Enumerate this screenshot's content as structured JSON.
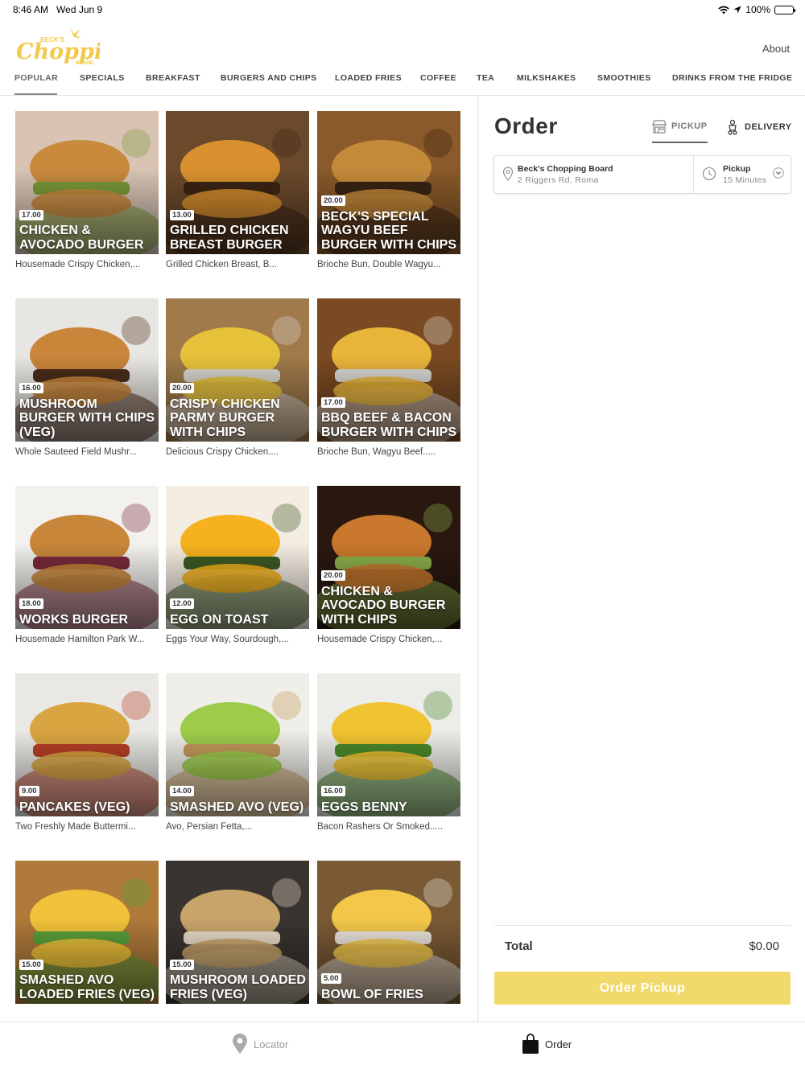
{
  "status_bar": {
    "time": "8:46 AM",
    "date": "Wed Jun 9",
    "battery": "100%"
  },
  "header": {
    "logo_alt": "Beck's Chopping Board",
    "about_label": "About",
    "brand_color": "#f2c94c"
  },
  "tabs": [
    {
      "label": "POPULAR",
      "active": true
    },
    {
      "label": "SPECIALS"
    },
    {
      "label": "BREAKFAST"
    },
    {
      "label": "BURGERS AND CHIPS"
    },
    {
      "label": "LOADED FRIES"
    },
    {
      "label": "COFFEE"
    },
    {
      "label": "TEA"
    },
    {
      "label": "MILKSHAKES"
    },
    {
      "label": "SMOOTHIES"
    },
    {
      "label": "DRINKS FROM THE FRIDGE"
    }
  ],
  "menu_items": [
    {
      "price": "17.00",
      "name": "CHICKEN & AVOCADO BURGER",
      "desc": "Housemade Crispy Chicken,...",
      "colors": [
        "#d9c4b4",
        "#c98a3e",
        "#7a9a3a"
      ]
    },
    {
      "price": "13.00",
      "name": "GRILLED CHICKEN BREAST BURGER",
      "desc": "Grilled Chicken Breast, B...",
      "colors": [
        "#6b4a2b",
        "#d9902f",
        "#3d2415"
      ]
    },
    {
      "price": "20.00",
      "name": "BECK'S SPECIAL WAGYU BEEF BURGER WITH CHIPS",
      "desc": "Brioche Bun, Double Wagyu...",
      "colors": [
        "#8a5a2a",
        "#c48a3a",
        "#3a2414"
      ]
    },
    {
      "price": "16.00",
      "name": "MUSHROOM BURGER WITH CHIPS (VEG)",
      "desc": "Whole Sauteed Field Mushr...",
      "colors": [
        "#e8e6e2",
        "#c9853a",
        "#4a2c1a"
      ]
    },
    {
      "price": "20.00",
      "name": "CRISPY CHICKEN PARMY BURGER WITH CHIPS",
      "desc": "Delicious Crispy Chicken....",
      "colors": [
        "#a07a4a",
        "#e6c23a",
        "#d8d4cc"
      ]
    },
    {
      "price": "17.00",
      "name": "BBQ BEEF & BACON BURGER WITH CHIPS",
      "desc": "Brioche Bun, Wagyu Beef.....",
      "colors": [
        "#7a4a22",
        "#e8b43a",
        "#d9d7d2"
      ]
    },
    {
      "price": "18.00",
      "name": "WORKS BURGER",
      "desc": "Housemade Hamilton Park W...",
      "colors": [
        "#f3f1ee",
        "#c8863a",
        "#7a2a3a"
      ]
    },
    {
      "price": "12.00",
      "name": "EGG ON TOAST",
      "desc": "Eggs Your Way, Sourdough,...",
      "colors": [
        "#f4ede2",
        "#f5b21e",
        "#3d5a24"
      ]
    },
    {
      "price": "20.00",
      "name": "CHICKEN & AVOCADO BURGER WITH CHIPS",
      "desc": "Housemade Crispy Chicken,...",
      "colors": [
        "#2a1810",
        "#c9782e",
        "#8ab04a"
      ]
    },
    {
      "price": "9.00",
      "name": "PANCAKES (VEG)",
      "desc": "Two Freshly Made Buttermi...",
      "colors": [
        "#e9e8e4",
        "#d9a540",
        "#b84026"
      ]
    },
    {
      "price": "14.00",
      "name": "SMASHED AVO (VEG)",
      "desc": "Avo, Persian Fetta,...",
      "colors": [
        "#f0eee8",
        "#9ccc4a",
        "#c49a5a"
      ]
    },
    {
      "price": "16.00",
      "name": "EGGS BENNY",
      "desc": "Bacon Rashers Or Smoked.....",
      "colors": [
        "#ecece8",
        "#f0c330",
        "#4a8a2a"
      ]
    },
    {
      "price": "15.00",
      "name": "SMASHED AVO LOADED FRIES (VEG)",
      "desc": "",
      "colors": [
        "#b07a3a",
        "#f2c23a",
        "#5aa03a"
      ]
    },
    {
      "price": "15.00",
      "name": "MUSHROOM LOADED FRIES (VEG)",
      "desc": "",
      "colors": [
        "#3a3430",
        "#c9a46a",
        "#e8dcc8"
      ]
    },
    {
      "price": "5.00",
      "name": "BOWL OF FRIES",
      "desc": "",
      "colors": [
        "#7a5a34",
        "#f3c84a",
        "#e8e4da"
      ]
    }
  ],
  "order": {
    "title": "Order",
    "pickup_label": "PICKUP",
    "delivery_label": "DELIVERY",
    "store_name": "Beck's Chopping Board",
    "store_address": "2 Riggers Rd, Roma",
    "mode": "Pickup",
    "wait_time": "15 Minutes",
    "total_label": "Total",
    "total_value": "$0.00",
    "button_label": "Order Pickup"
  },
  "bottom_nav": {
    "locator": "Locator",
    "order": "Order"
  }
}
